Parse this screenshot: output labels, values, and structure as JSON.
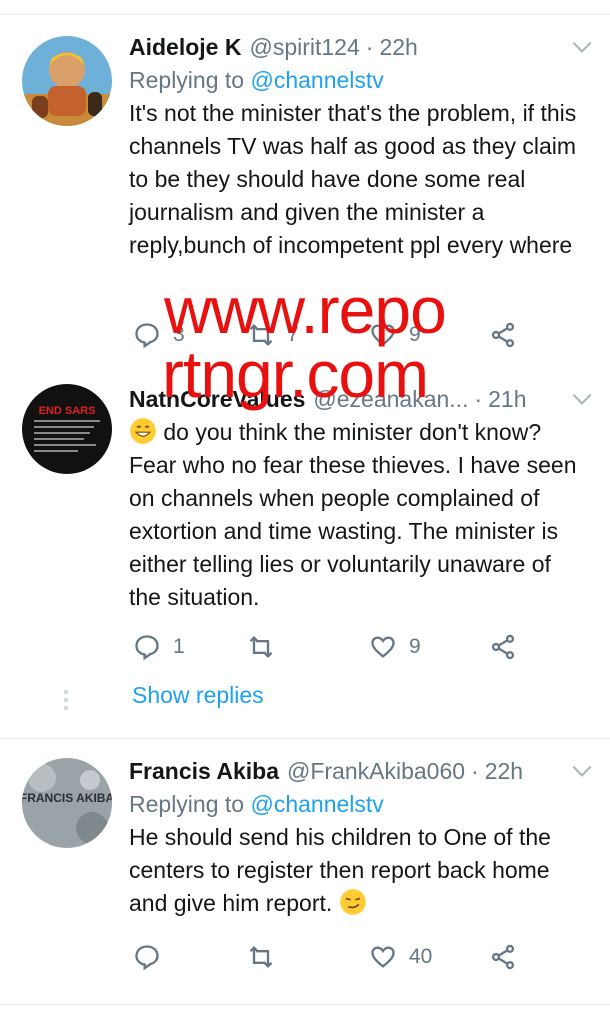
{
  "tweets": [
    {
      "name": "Aideloje K",
      "handle": "@spirit124",
      "time": "22h",
      "replying_prefix": "Replying to",
      "replying_to": "@channelstv",
      "body": "It's not the minister that's the problem, if this channels TV was half as good as they claim to be they should have done some real journalism and given the minister a reply,bunch of incompetent ppl every where",
      "replies": "3",
      "retweets": "7",
      "likes": "9"
    },
    {
      "name": "NathCoreValues",
      "handle": "@ezeanakan...",
      "time": "21h",
      "body": "do you think the minister don't know? Fear who no fear these thieves. I have seen on channels when people complained of extortion and time wasting. The minister is either telling lies or voluntarily unaware of the situation.",
      "replies": "1",
      "retweets": "",
      "likes": "9",
      "avatar_text": "END SARS"
    },
    {
      "name": "Francis Akiba",
      "handle": "@FrankAkiba060",
      "time": "22h",
      "replying_prefix": "Replying to",
      "replying_to": "@channelstv",
      "body": "He should send his children to One of the centers to register then report back home and give him report.",
      "replies": "",
      "retweets": "",
      "likes": "40",
      "avatar_text": "FRANCIS AKIBA"
    }
  ],
  "show_replies": "Show replies",
  "watermark": {
    "line1": "www.repo",
    "line2": "rtngr.com"
  },
  "colors": {
    "accent": "#1da1f2",
    "muted": "#657786",
    "watermark": "#e8110f"
  }
}
